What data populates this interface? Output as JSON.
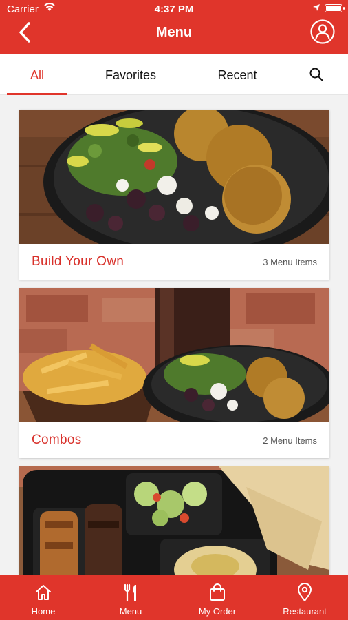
{
  "status_bar": {
    "carrier": "Carrier",
    "time": "4:37 PM"
  },
  "header": {
    "title": "Menu"
  },
  "tabs": [
    {
      "label": "All",
      "active": true
    },
    {
      "label": "Favorites",
      "active": false
    },
    {
      "label": "Recent",
      "active": false
    }
  ],
  "categories": [
    {
      "name": "Build Your Own",
      "count": "3 Menu Items"
    },
    {
      "name": "Combos",
      "count": "2 Menu Items"
    },
    {
      "name": "",
      "count": ""
    }
  ],
  "bottom_nav": [
    {
      "label": "Home",
      "icon": "home-icon"
    },
    {
      "label": "Menu",
      "icon": "fork-knife-icon"
    },
    {
      "label": "My Order",
      "icon": "bag-icon"
    },
    {
      "label": "Restaurant",
      "icon": "location-pin-icon"
    }
  ],
  "colors": {
    "brand": "#e0352b",
    "text": "#111111",
    "muted": "#555555"
  }
}
